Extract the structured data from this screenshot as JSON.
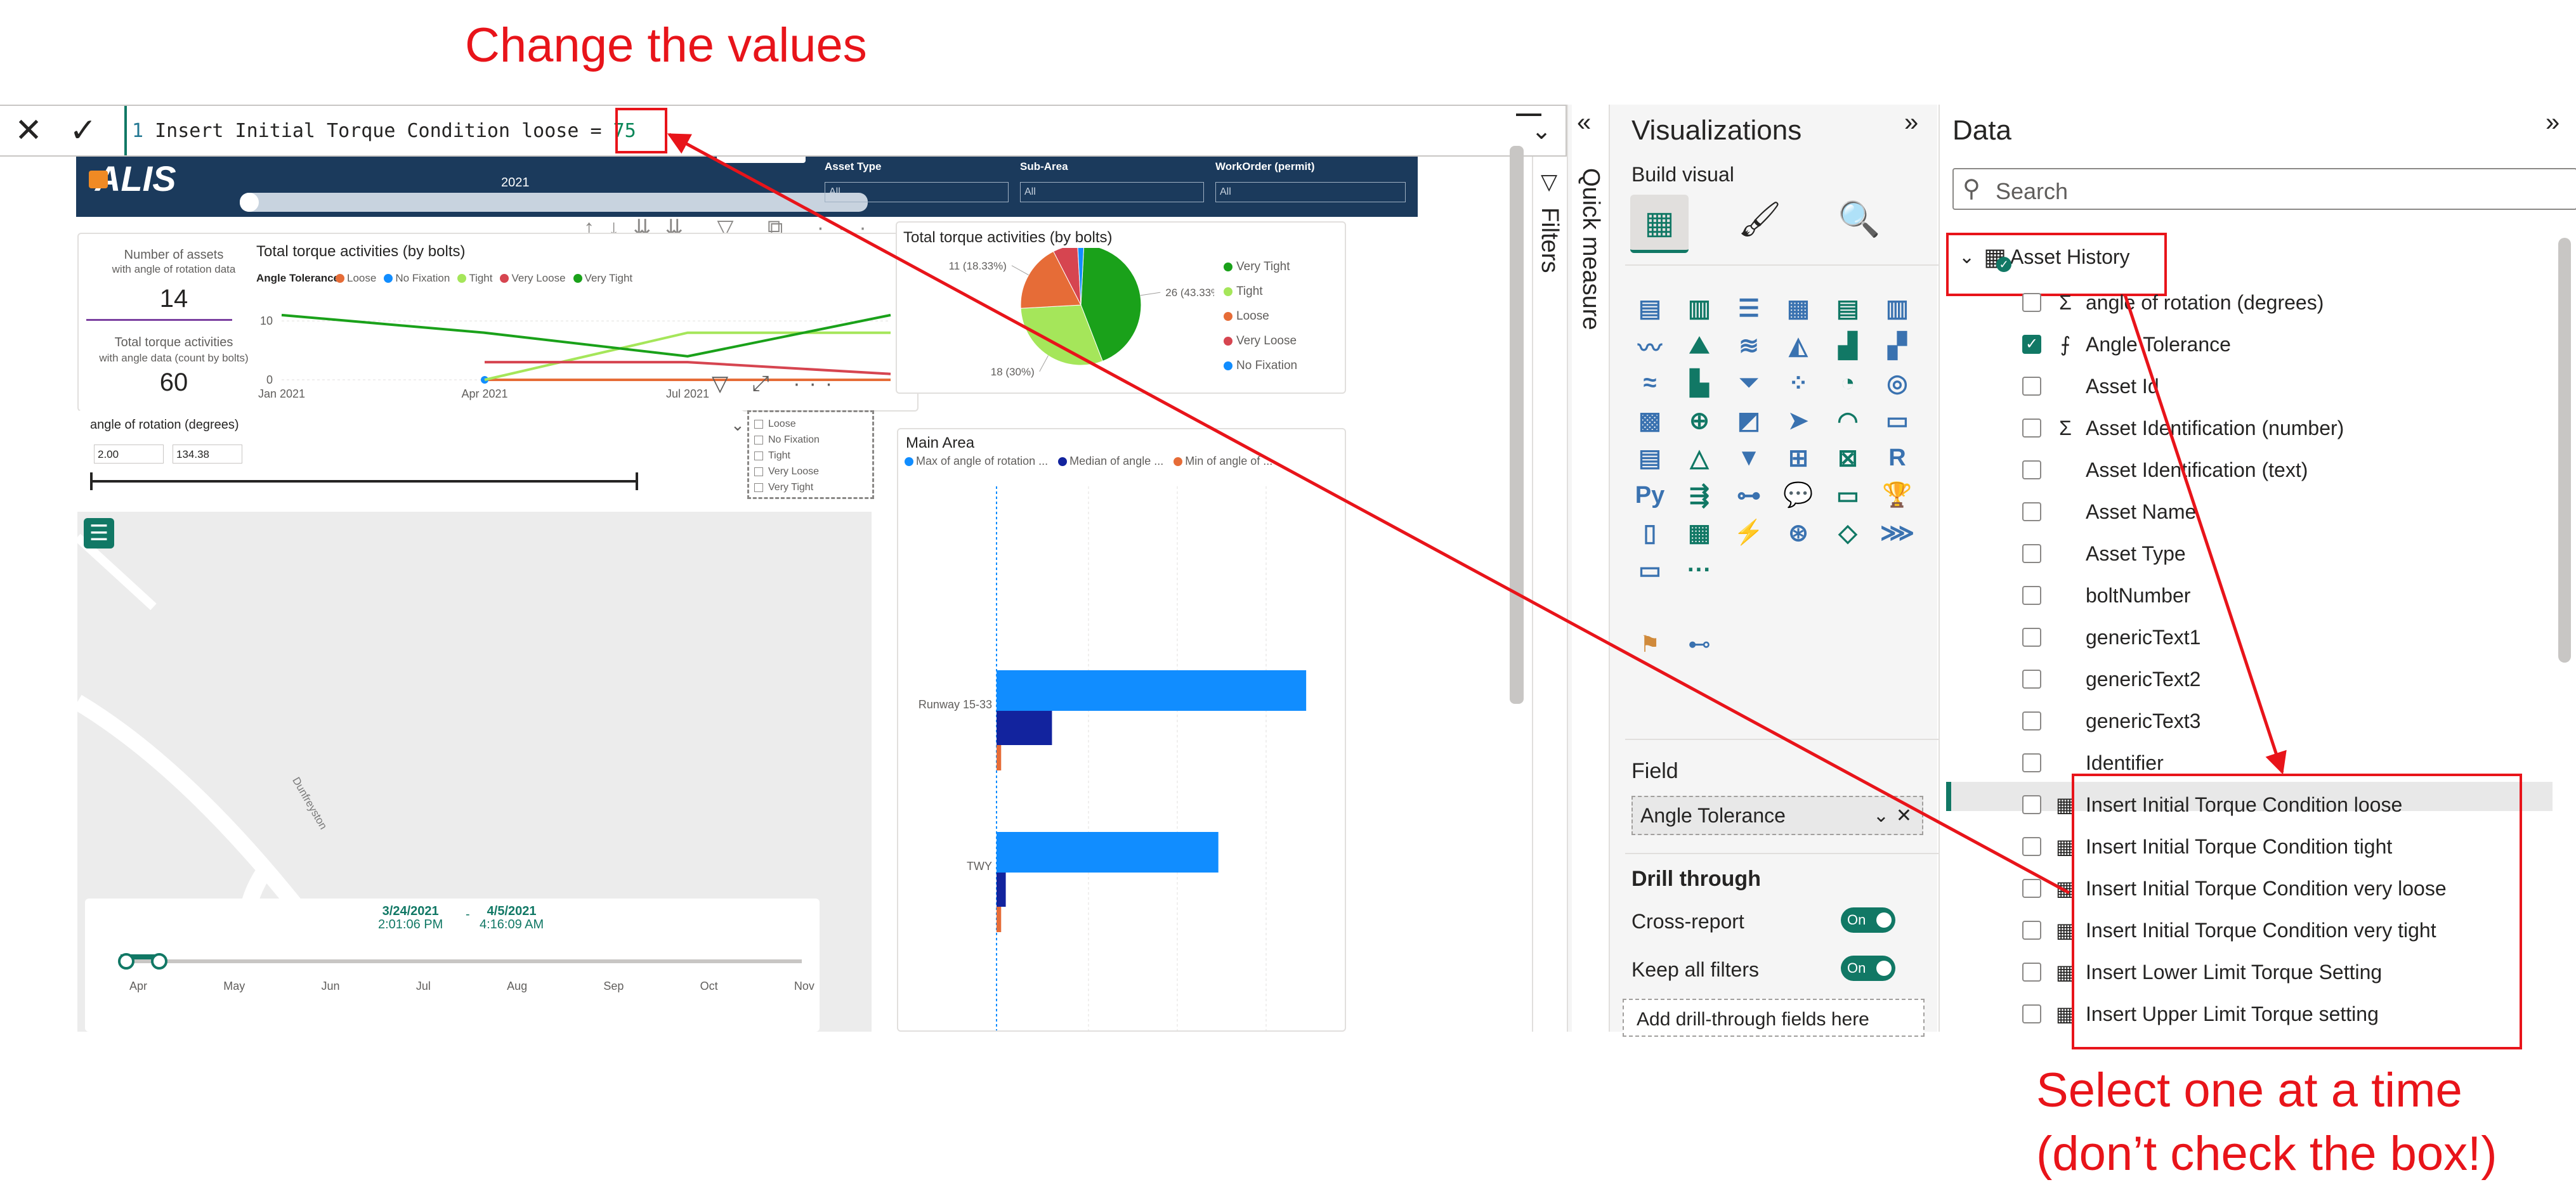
{
  "annotations": {
    "top": "Change the values",
    "bottom_line1": "Select one at a time",
    "bottom_line2": "(don’t check the box!)"
  },
  "formula_bar": {
    "line_number": "1",
    "expression": "Insert Initial Torque Condition loose = ",
    "value": "75"
  },
  "report": {
    "brand": "ALIS",
    "year_label": "2021",
    "slicers": [
      {
        "label": "Asset Type",
        "value": "All"
      },
      {
        "label": "Sub-Area",
        "value": "All"
      },
      {
        "label": "WorkOrder (permit)",
        "value": "All"
      }
    ],
    "kpi": {
      "assets_label": "Number of assets",
      "assets_sub": "with angle of rotation data",
      "assets_value": "14",
      "torque_label": "Total torque activities",
      "torque_sub": "with angle data (count by bolts)",
      "torque_value": "60"
    },
    "angle_slicer": {
      "label": "angle of rotation (degrees)",
      "min": "2.00",
      "max": "134.38"
    },
    "tolerance_options": [
      "Loose",
      "No Fixation",
      "Tight",
      "Very Loose",
      "Very Tight"
    ],
    "date_range": {
      "start_date": "3/24/2021",
      "start_time": "2:01:06 PM",
      "end_date": "4/5/2021",
      "end_time": "4:16:09 AM",
      "months": [
        "Apr",
        "May",
        "Jun",
        "Jul",
        "Aug",
        "Sep",
        "Oct",
        "Nov"
      ]
    },
    "map_street": "Dunfreyston"
  },
  "chart_data": [
    {
      "type": "line",
      "title": "Total torque activities (by bolts)",
      "legend_title": "Angle Tolerance",
      "x": [
        "Jan 2021",
        "Apr 2021",
        "Jul 2021",
        ""
      ],
      "yticks": [
        "0",
        "10"
      ],
      "ylim": [
        0,
        14
      ],
      "series": [
        {
          "name": "Loose",
          "color": "#e66c37",
          "values": [
            null,
            0,
            0,
            0
          ]
        },
        {
          "name": "No Fixation",
          "color": "#118dff",
          "values": [
            null,
            0,
            null,
            null
          ]
        },
        {
          "name": "Tight",
          "color": "#a5e65a",
          "values": [
            null,
            0,
            8,
            8
          ]
        },
        {
          "name": "Very Loose",
          "color": "#d64550",
          "values": [
            null,
            3,
            3,
            1
          ]
        },
        {
          "name": "Very Tight",
          "color": "#1aa11a",
          "values": [
            11,
            8,
            4,
            11
          ]
        }
      ],
      "legend": "top"
    },
    {
      "type": "pie",
      "title": "Total torque activities (by bolts)",
      "slices": [
        {
          "name": "Very Tight",
          "value": 26,
          "label": "26 (43.33%)",
          "color": "#1aa11a"
        },
        {
          "name": "Tight",
          "value": 18,
          "label": "18 (30%)",
          "color": "#a5e65a"
        },
        {
          "name": "Loose",
          "value": 11,
          "label": "11 (18.33%)",
          "color": "#e66c37"
        },
        {
          "name": "Very Loose",
          "value": 4,
          "label": "4 (6.67%)",
          "color": "#d64550"
        },
        {
          "name": "No Fixation",
          "value": 1,
          "label": "",
          "color": "#118dff"
        }
      ],
      "legend": "right"
    },
    {
      "type": "bar",
      "title": "Main Area",
      "categories": [
        "Runway 15-33",
        "TWY"
      ],
      "series": [
        {
          "name": "Max of angle of rotation ...",
          "color": "#118dff",
          "values": [
            134,
            96
          ]
        },
        {
          "name": "Median of angle ...",
          "color": "#12239e",
          "values": [
            24,
            4
          ]
        },
        {
          "name": "Min of angle of ...",
          "color": "#e66c37",
          "values": [
            2,
            2
          ]
        }
      ],
      "legend": "top"
    }
  ],
  "visualizations": {
    "title": "Visualizations",
    "build_visual": "Build visual",
    "quick_measure": "Quick measure",
    "filters": "Filters",
    "field_label": "Field",
    "field_value": "Angle Tolerance",
    "drill_through": "Drill through",
    "cross_report": "Cross-report",
    "keep_all_filters": "Keep all filters",
    "toggle_on": "On",
    "add_drill": "Add drill-through fields here",
    "python_label": "Py",
    "r_label": "R",
    "more": "···"
  },
  "data_pane": {
    "title": "Data",
    "search_placeholder": "Search",
    "table_name": "Asset History",
    "fields": [
      {
        "label": "angle of rotation (degrees)",
        "icon": "sigma-icon",
        "checked": false
      },
      {
        "label": "Angle Tolerance",
        "icon": "calculated-column-icon",
        "checked": true
      },
      {
        "label": "Asset Id",
        "icon": "",
        "checked": false
      },
      {
        "label": "Asset Identification (number)",
        "icon": "sigma-icon",
        "checked": false
      },
      {
        "label": "Asset Identification (text)",
        "icon": "",
        "checked": false
      },
      {
        "label": "Asset Name",
        "icon": "",
        "checked": false
      },
      {
        "label": "Asset Type",
        "icon": "",
        "checked": false
      },
      {
        "label": "boltNumber",
        "icon": "",
        "checked": false
      },
      {
        "label": "genericText1",
        "icon": "",
        "checked": false
      },
      {
        "label": "genericText2",
        "icon": "",
        "checked": false
      },
      {
        "label": "genericText3",
        "icon": "",
        "checked": false
      },
      {
        "label": "Identifier",
        "icon": "",
        "checked": false
      },
      {
        "label": "Insert Initial Torque Condition loose",
        "icon": "measure-icon",
        "checked": false
      },
      {
        "label": "Insert Initial Torque Condition tight",
        "icon": "measure-icon",
        "checked": false
      },
      {
        "label": "Insert Initial Torque Condition very loose",
        "icon": "measure-icon",
        "checked": false
      },
      {
        "label": "Insert Initial Torque Condition very tight",
        "icon": "measure-icon",
        "checked": false
      },
      {
        "label": "Insert Lower Limit Torque Setting",
        "icon": "measure-icon",
        "checked": false
      },
      {
        "label": "Insert Upper Limit Torque setting",
        "icon": "measure-icon",
        "checked": false
      }
    ]
  },
  "colors": {
    "annotation_red": "#e8141a",
    "header_navy": "#1b3a5c",
    "toggle_green": "#117865"
  }
}
